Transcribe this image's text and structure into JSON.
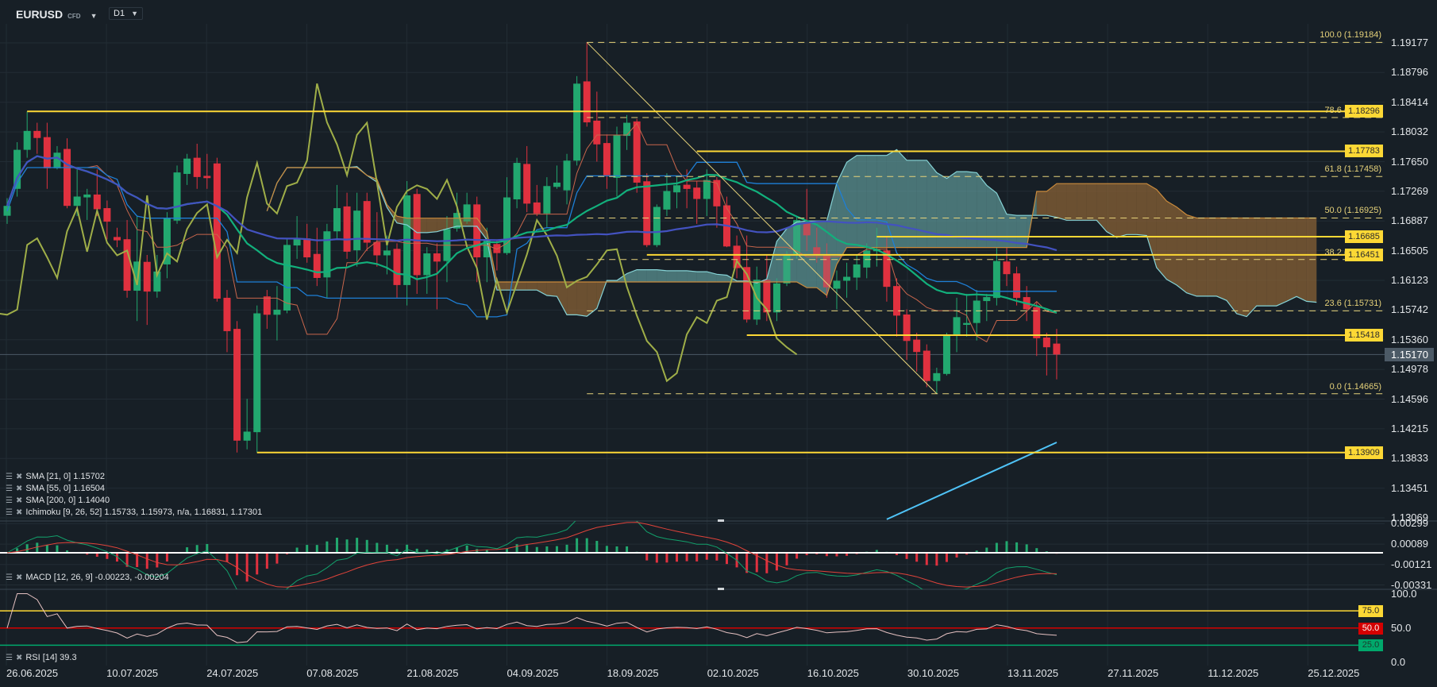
{
  "header": {
    "symbol": "EURUSD",
    "instrument_type": "CFD",
    "timeframe": "D1"
  },
  "colors": {
    "bg": "#171f26",
    "grid": "#222c34",
    "up": "#22a86f",
    "down": "#e0313f",
    "level": "#fdd835",
    "fib": "#e6d27a",
    "sma21": "#12b07c",
    "sma55": "#4352c0",
    "sma200": "#4fc3f7",
    "tenkan": "#c8664c",
    "kijun": "#1e7fd6",
    "chikou": "#9fae48",
    "spanA": "#86d3d6",
    "spanB": "#c98a3c",
    "cloud_bull": "rgba(98,160,160,0.55)",
    "cloud_bear": "rgba(150,105,55,0.55)",
    "macd": "#12a06b",
    "signal": "#e0433a",
    "rsi": "#e5c1c1"
  },
  "price_axis": {
    "min": 1.13069,
    "max": 1.19177,
    "ticks": [
      "1.19177",
      "1.18796",
      "1.18414",
      "1.18032",
      "1.17650",
      "1.17269",
      "1.16887",
      "1.16505",
      "1.16123",
      "1.15742",
      "1.15360",
      "1.14978",
      "1.14596",
      "1.14215",
      "1.13833",
      "1.13451",
      "1.13069"
    ],
    "current": "1.15170",
    "current_value": 1.1517
  },
  "macd_axis": {
    "ticks": [
      "0.00299",
      "0.00089",
      "-0.00121",
      "-0.00331"
    ],
    "tick_values": [
      0.00299,
      0.00089,
      -0.00121,
      -0.00331
    ]
  },
  "rsi_axis": {
    "ticks": [
      "100.0",
      "50.0",
      "0.0"
    ],
    "tick_values": [
      100,
      50,
      0
    ],
    "levels": [
      {
        "label": "75.0",
        "value": 75,
        "color": "#fdd835",
        "text": "#2b2b2b"
      },
      {
        "label": "50.0",
        "value": 50,
        "color": "#d50000",
        "text": "#ffffff"
      },
      {
        "label": "25.0",
        "value": 25,
        "color": "#00a86b",
        "text": "#1c3b2e"
      }
    ]
  },
  "dates": [
    "26.06.2025",
    "10.07.2025",
    "24.07.2025",
    "07.08.2025",
    "21.08.2025",
    "04.09.2025",
    "18.09.2025",
    "02.10.2025",
    "16.10.2025",
    "30.10.2025",
    "13.11.2025",
    "27.11.2025",
    "11.12.2025",
    "25.12.2025"
  ],
  "legend": {
    "sma21": "SMA [21, 0] 1.15702",
    "sma55": "SMA [55, 0] 1.16504",
    "sma200": "SMA [200, 0] 1.14040",
    "ichimoku": "Ichimoku  [9, 26, 52] 1.15733,  1.15973,  n/a,  1.16831,  1.17301",
    "macd": "MACD [12, 26, 9] -0.00223,  -0.00204",
    "rsi": "RSI  [14]  39.3"
  },
  "levels": [
    {
      "price": 1.18296,
      "label": "1.18296",
      "from_bar": 3
    },
    {
      "price": 1.17783,
      "label": "1.17783",
      "from_bar": 70
    },
    {
      "price": 1.16685,
      "label": "1.16685",
      "from_bar": 88
    },
    {
      "price": 1.16451,
      "label": "1.16451",
      "from_bar": 65
    },
    {
      "price": 1.15418,
      "label": "1.15418",
      "from_bar": 75
    },
    {
      "price": 1.13909,
      "label": "1.13909",
      "from_bar": 26
    }
  ],
  "fibonacci": {
    "high": 1.19184,
    "low": 1.14665,
    "high_bar": 59,
    "low_bar": 94,
    "levels": [
      {
        "pct": 100.0,
        "label": "100.0 (1.19184)",
        "price": 1.19184
      },
      {
        "pct": 78.6,
        "label": "78.6 (1.18217)",
        "price": 1.18217
      },
      {
        "pct": 61.8,
        "label": "61.8 (1.17458)",
        "price": 1.17458
      },
      {
        "pct": 50.0,
        "label": "50.0 (1.16925)",
        "price": 1.16925
      },
      {
        "pct": 38.2,
        "label": "38.2 (1.16391)",
        "price": 1.16391
      },
      {
        "pct": 23.6,
        "label": "23.6 (1.15731)",
        "price": 1.15731
      },
      {
        "pct": 0.0,
        "label": "0.0 (1.14665)",
        "price": 1.14665
      }
    ]
  },
  "sma200_visible": {
    "from_bar": 88,
    "from": 1.1305,
    "to": 1.1404
  },
  "chart_data": {
    "type": "candlestick",
    "fields": [
      "open",
      "high",
      "low",
      "close"
    ],
    "candles": [
      [
        1.16954,
        1.1718,
        1.1685,
        1.17081
      ],
      [
        1.173,
        1.179,
        1.172,
        1.17802
      ],
      [
        1.17802,
        1.18296,
        1.177,
        1.18045
      ],
      [
        1.18045,
        1.1815,
        1.1775,
        1.17954
      ],
      [
        1.17965,
        1.1815,
        1.173,
        1.17565
      ],
      [
        1.17565,
        1.1785,
        1.1755,
        1.17765
      ],
      [
        1.17813,
        1.1795,
        1.1705,
        1.17081
      ],
      [
        1.17081,
        1.1755,
        1.1695,
        1.17201
      ],
      [
        1.1719,
        1.173,
        1.169,
        1.17227
      ],
      [
        1.17227,
        1.1755,
        1.1695,
        1.17038
      ],
      [
        1.17052,
        1.1715,
        1.1665,
        1.16878
      ],
      [
        1.16681,
        1.168,
        1.1655,
        1.16638
      ],
      [
        1.16652,
        1.169,
        1.159,
        1.1599
      ],
      [
        1.1599,
        1.1695,
        1.156,
        1.16365
      ],
      [
        1.16361,
        1.1645,
        1.1555,
        1.15979
      ],
      [
        1.15979,
        1.1645,
        1.159,
        1.16237
      ],
      [
        1.16328,
        1.17,
        1.1615,
        1.16925
      ],
      [
        1.16892,
        1.176,
        1.1685,
        1.17511
      ],
      [
        1.17492,
        1.1775,
        1.1735,
        1.17689
      ],
      [
        1.177,
        1.1788,
        1.173,
        1.17452
      ],
      [
        1.17467,
        1.1775,
        1.173,
        1.17438
      ],
      [
        1.17627,
        1.177,
        1.1585,
        1.15888
      ],
      [
        1.15899,
        1.16,
        1.152,
        1.1547
      ],
      [
        1.15499,
        1.156,
        1.13909,
        1.14062
      ],
      [
        1.14062,
        1.146,
        1.1395,
        1.14178
      ],
      [
        1.14171,
        1.158,
        1.13909,
        1.15699
      ],
      [
        1.15917,
        1.16,
        1.155,
        1.15681
      ],
      [
        1.15681,
        1.1605,
        1.1535,
        1.15746
      ],
      [
        1.15735,
        1.1665,
        1.157,
        1.16579
      ],
      [
        1.16572,
        1.1695,
        1.164,
        1.16663
      ],
      [
        1.16663,
        1.1685,
        1.1635,
        1.16419
      ],
      [
        1.16463,
        1.168,
        1.1605,
        1.16154
      ],
      [
        1.16161,
        1.1685,
        1.159,
        1.16754
      ],
      [
        1.16754,
        1.1735,
        1.1665,
        1.17052
      ],
      [
        1.17074,
        1.1725,
        1.164,
        1.16492
      ],
      [
        1.1651,
        1.1725,
        1.163,
        1.1702
      ],
      [
        1.17143,
        1.1725,
        1.165,
        1.16608
      ],
      [
        1.16616,
        1.17,
        1.163,
        1.16445
      ],
      [
        1.16445,
        1.167,
        1.162,
        1.16507
      ],
      [
        1.16528,
        1.166,
        1.159,
        1.16063
      ],
      [
        1.16063,
        1.174,
        1.158,
        1.17216
      ],
      [
        1.17234,
        1.173,
        1.1595,
        1.1619
      ],
      [
        1.1619,
        1.1655,
        1.1595,
        1.1647
      ],
      [
        1.1647,
        1.166,
        1.1575,
        1.16365
      ],
      [
        1.16372,
        1.1695,
        1.161,
        1.16783
      ],
      [
        1.1679,
        1.1725,
        1.1675,
        1.1699
      ],
      [
        1.16881,
        1.1725,
        1.1685,
        1.171
      ],
      [
        1.171,
        1.172,
        1.161,
        1.16419
      ],
      [
        1.16419,
        1.168,
        1.161,
        1.16645
      ],
      [
        1.1659,
        1.1665,
        1.1625,
        1.16474
      ],
      [
        1.16474,
        1.1745,
        1.1645,
        1.1719
      ],
      [
        1.17165,
        1.177,
        1.1705,
        1.17634
      ],
      [
        1.1762,
        1.1785,
        1.17,
        1.1711
      ],
      [
        1.17125,
        1.1735,
        1.1695,
        1.16983
      ],
      [
        1.16983,
        1.1745,
        1.168,
        1.17336
      ],
      [
        1.17325,
        1.176,
        1.173,
        1.1738
      ],
      [
        1.17281,
        1.1775,
        1.171,
        1.17663
      ],
      [
        1.17663,
        1.1875,
        1.176,
        1.18653
      ],
      [
        1.18682,
        1.19184,
        1.181,
        1.18155
      ],
      [
        1.18177,
        1.1855,
        1.1765,
        1.17872
      ],
      [
        1.17889,
        1.18,
        1.173,
        1.17475
      ],
      [
        1.17441,
        1.181,
        1.172,
        1.17994
      ],
      [
        1.17981,
        1.1825,
        1.178,
        1.1815
      ],
      [
        1.18167,
        1.182,
        1.1725,
        1.1738
      ],
      [
        1.17397,
        1.175,
        1.1655,
        1.16576
      ],
      [
        1.16576,
        1.171,
        1.1655,
        1.17068
      ],
      [
        1.17034,
        1.175,
        1.1695,
        1.17272
      ],
      [
        1.17255,
        1.1745,
        1.1705,
        1.17346
      ],
      [
        1.17353,
        1.1755,
        1.1705,
        1.17299
      ],
      [
        1.17316,
        1.174,
        1.1685,
        1.1717
      ],
      [
        1.1717,
        1.1755,
        1.1695,
        1.17414
      ],
      [
        1.17414,
        1.1745,
        1.168,
        1.17075
      ],
      [
        1.17088,
        1.172,
        1.1655,
        1.16559
      ],
      [
        1.16569,
        1.167,
        1.1615,
        1.16281
      ],
      [
        1.16294,
        1.167,
        1.1558,
        1.15619
      ],
      [
        1.15619,
        1.163,
        1.1555,
        1.16131
      ],
      [
        1.16131,
        1.1645,
        1.156,
        1.15711
      ],
      [
        1.15711,
        1.1615,
        1.156,
        1.16084
      ],
      [
        1.16084,
        1.165,
        1.1605,
        1.16457
      ],
      [
        1.16457,
        1.1695,
        1.164,
        1.16898
      ],
      [
        1.16864,
        1.173,
        1.165,
        1.16702
      ],
      [
        1.16549,
        1.168,
        1.1635,
        1.1644
      ],
      [
        1.1644,
        1.166,
        1.159,
        1.16033
      ],
      [
        1.16016,
        1.1625,
        1.1575,
        1.16118
      ],
      [
        1.16118,
        1.1635,
        1.159,
        1.16169
      ],
      [
        1.16159,
        1.1645,
        1.16,
        1.16328
      ],
      [
        1.16288,
        1.166,
        1.1615,
        1.16508
      ],
      [
        1.16498,
        1.168,
        1.163,
        1.16525
      ],
      [
        1.16508,
        1.1668,
        1.1585,
        1.1604
      ],
      [
        1.1605,
        1.1615,
        1.154,
        1.1567
      ],
      [
        1.15684,
        1.1575,
        1.151,
        1.15344
      ],
      [
        1.15361,
        1.1545,
        1.1495,
        1.15202
      ],
      [
        1.15219,
        1.153,
        1.1475,
        1.14829
      ],
      [
        1.14829,
        1.15,
        1.14665,
        1.1493
      ],
      [
        1.1492,
        1.1545,
        1.149,
        1.15429
      ],
      [
        1.15422,
        1.159,
        1.152,
        1.1565
      ],
      [
        1.15551,
        1.1595,
        1.154,
        1.15575
      ],
      [
        1.15575,
        1.16,
        1.1535,
        1.15863
      ],
      [
        1.15857,
        1.1595,
        1.156,
        1.15908
      ],
      [
        1.15897,
        1.1655,
        1.158,
        1.16372
      ],
      [
        1.16366,
        1.1655,
        1.1605,
        1.16203
      ],
      [
        1.16213,
        1.163,
        1.158,
        1.15897
      ],
      [
        1.15908,
        1.1605,
        1.156,
        1.15751
      ],
      [
        1.15779,
        1.1585,
        1.1515,
        1.15378
      ],
      [
        1.15388,
        1.1545,
        1.149,
        1.15263
      ],
      [
        1.1531,
        1.155,
        1.1485,
        1.1517
      ]
    ]
  }
}
